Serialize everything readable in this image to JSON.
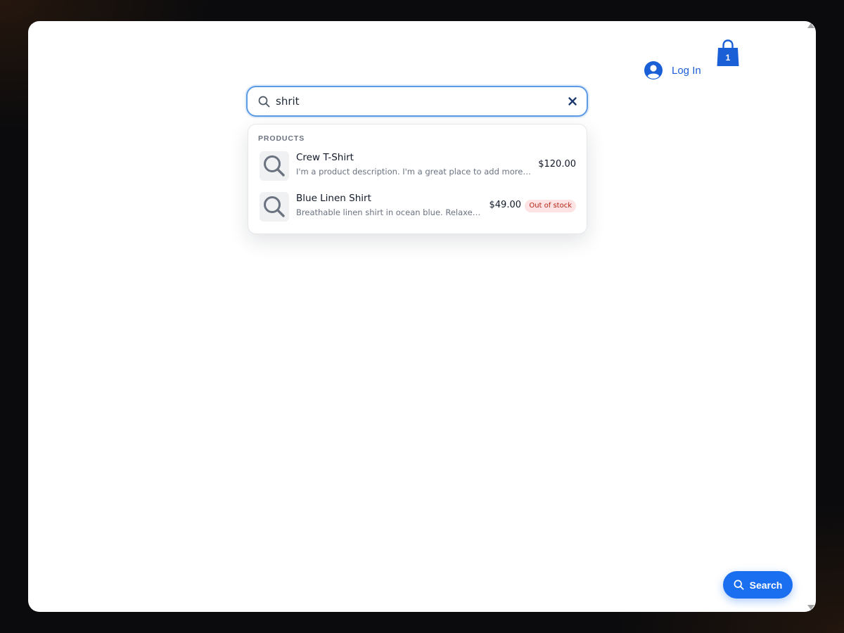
{
  "header": {
    "login_label": "Log In",
    "cart_count": "1"
  },
  "search": {
    "query": "shrit",
    "placeholder": ""
  },
  "results": {
    "section_label": "PRODUCTS",
    "items": [
      {
        "name": "Crew T-Shirt",
        "description": "I'm a product description. I'm a great place to add more details about your product",
        "price": "$120.00",
        "badge": ""
      },
      {
        "name": "Blue Linen Shirt",
        "description": "Breathable linen shirt in ocean blue. Relaxed fit, perfect for summer",
        "price": "$49.00",
        "badge": "Out of stock"
      }
    ]
  },
  "fab": {
    "label": "Search"
  },
  "colors": {
    "accent": "#1a6ef0",
    "link": "#1a5fd6",
    "badge_bg": "#fde3e3",
    "badge_text": "#b42318"
  },
  "icons": [
    "user-avatar-icon",
    "shopping-bag-icon",
    "search-icon",
    "clear-icon"
  ]
}
